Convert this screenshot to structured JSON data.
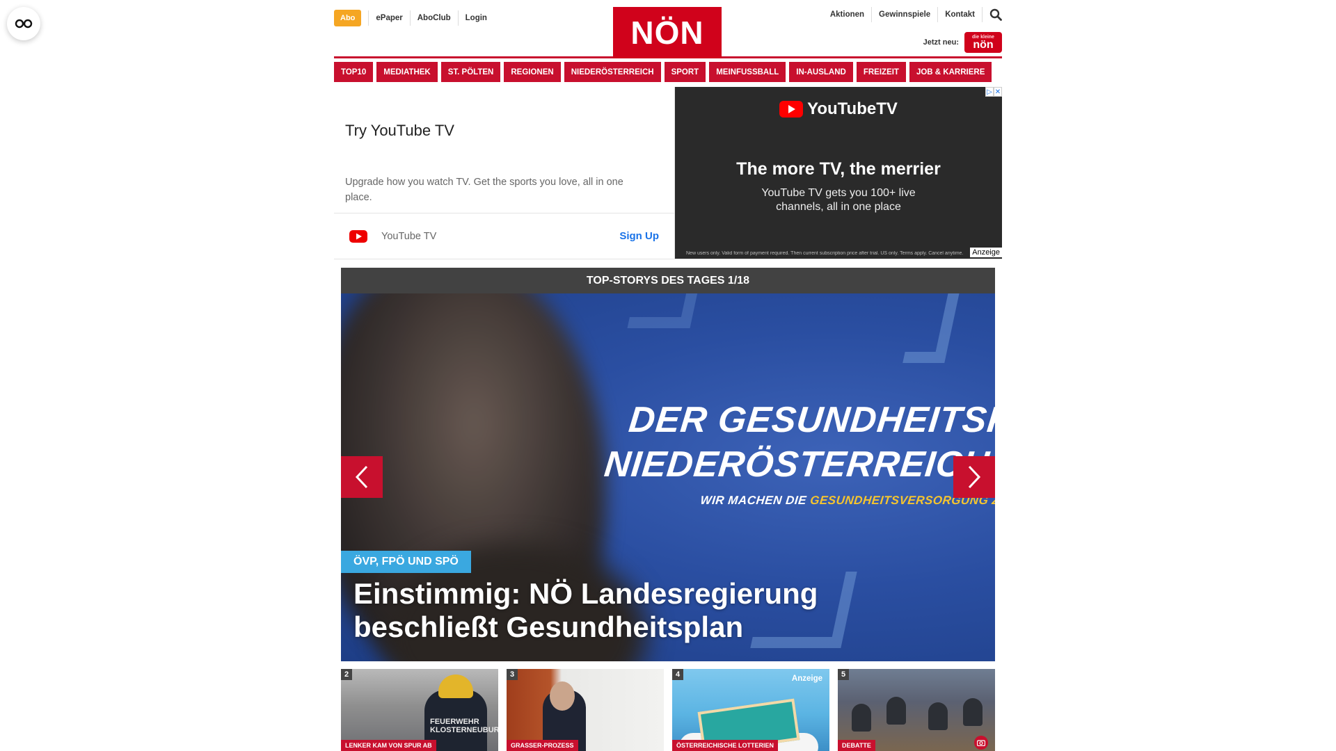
{
  "header": {
    "abo_label": "Abo",
    "left_links": [
      "ePaper",
      "AboClub",
      "Login"
    ],
    "logo_text": "NÖN",
    "right_links": [
      "Aktionen",
      "Gewinnspiele",
      "Kontakt"
    ],
    "jetzt_neu_label": "Jetzt neu:",
    "jetzt_badge_top": "die kleine",
    "jetzt_badge_main": "nön"
  },
  "nav": {
    "items": [
      "TOP10",
      "MEDIATHEK",
      "ST. PÖLTEN",
      "REGIONEN",
      "NIEDERÖSTERREICH",
      "SPORT",
      "MEINFUSSBALL",
      "IN-AUSLAND",
      "FREIZEIT",
      "JOB & KARRIERE"
    ]
  },
  "ad": {
    "title": "Try YouTube TV",
    "description": "Upgrade how you watch TV. Get the sports you love, all in one place.",
    "brand": "YouTube TV",
    "cta": "Sign Up",
    "banner_brand": "YouTubeTV",
    "banner_headline": "The more TV, the merrier",
    "banner_sub": "YouTube TV gets you 100+ live channels, all in one place",
    "banner_fine_print": "New users only. Valid form of payment required. Then current subscription price after trial. US only. Terms apply. Cancel anytime.",
    "anzeige_label": "Anzeige"
  },
  "carousel": {
    "title": "TOP-STORYS DES TAGES 1/18",
    "slide_line1": "DER GESUNDHEITSPLAN",
    "slide_line2": "NIEDERÖSTERREICH.",
    "slide_line3_prefix": "WIR MACHEN DIE",
    "slide_line3_highlight": "GESUNDHEITSVERSORGUNG ZUKUNFTSFIT.",
    "kicker": "ÖVP, FPÖ UND SPÖ",
    "headline_line1": "Einstimmig: NÖ Landesregierung",
    "headline_line2": "beschließt Gesundheitsplan"
  },
  "thumbs": [
    {
      "num": "2",
      "label": "LENKER KAM VON SPUR AB",
      "overlay": "FEUERWEHR KLOSTERNEUBURG"
    },
    {
      "num": "3",
      "label": "GRASSER-PROZESS"
    },
    {
      "num": "4",
      "label": "ÖSTERREICHISCHE LOTTERIEN",
      "anzeige": "Anzeige"
    },
    {
      "num": "5",
      "label": "DEBATTE"
    }
  ],
  "colors": {
    "brand_red": "#c8102e",
    "abo_orange": "#f5a623",
    "kicker_blue": "#3aa8e0",
    "link_blue": "#1a73e8"
  },
  "icons": {
    "widget": "glasses-icon",
    "search": "search-icon",
    "youtube": "youtube-play-icon",
    "arrow_left": "chevron-left-icon",
    "arrow_right": "chevron-right-icon",
    "camera": "camera-icon"
  }
}
